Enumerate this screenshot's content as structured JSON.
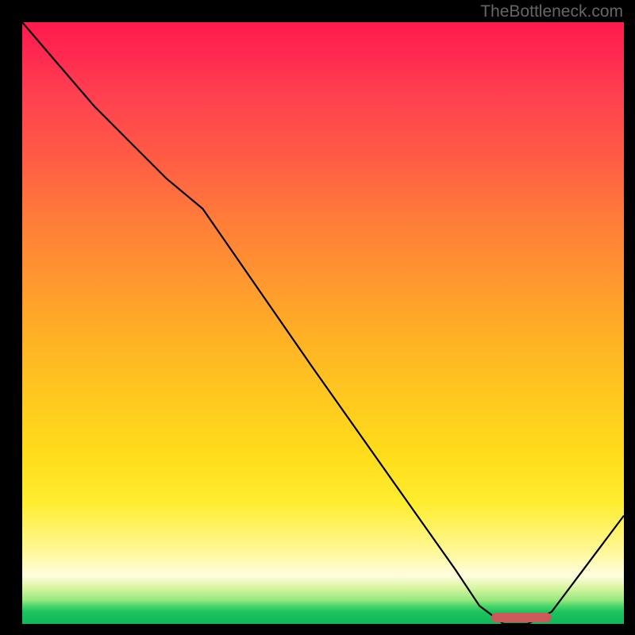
{
  "watermark": "TheBottleneck.com",
  "chart_data": {
    "type": "line",
    "title": "",
    "xlabel": "",
    "ylabel": "",
    "x": [
      0,
      6,
      12,
      18,
      24,
      30,
      48,
      72,
      76,
      80,
      84,
      88,
      100
    ],
    "values": [
      100,
      93,
      86,
      80,
      74,
      69,
      43,
      9,
      3,
      0,
      0,
      2,
      18
    ],
    "xlim": [
      0,
      100
    ],
    "ylim": [
      0,
      100
    ],
    "marker": {
      "x_start": 78,
      "x_end": 88,
      "y": 1
    },
    "background": "gradient-red-yellow-green"
  }
}
